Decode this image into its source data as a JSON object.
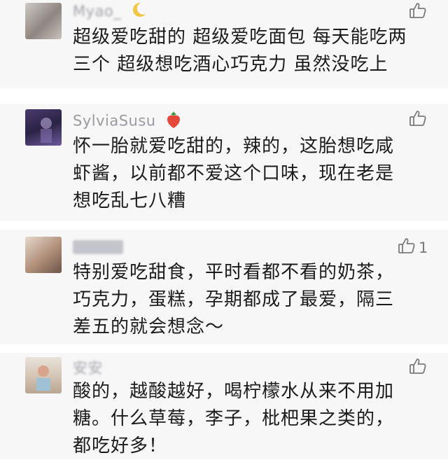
{
  "comments": [
    {
      "nickname": "Myao_",
      "nickname_blurred": true,
      "badge_icon": "crescent-moon-icon",
      "text_lines": [
        "超级爱吃甜的 超级爱吃面包 每天能吃两",
        "三个 超级想吃酒心巧克力 虽然没吃上"
      ],
      "likes": ""
    },
    {
      "nickname": "SylviaSusu",
      "nickname_blurred": false,
      "badge_icon": "strawberry-icon",
      "text_lines": [
        "怀一胎就爱吃甜的，辣的，这胎想吃咸",
        "虾酱，以前都不爱这个口味，现在老是",
        "想吃乱七八糟"
      ],
      "likes": ""
    },
    {
      "nickname": "",
      "nickname_blurred": true,
      "badge_icon": "",
      "text_lines": [
        "特别爱吃甜食，平时看都不看的奶茶，",
        "巧克力，蛋糕，孕期都成了最爱，隔三",
        "差五的就会想念～"
      ],
      "likes": "1"
    },
    {
      "nickname": "安安",
      "nickname_blurred": true,
      "badge_icon": "",
      "text_lines": [
        "酸的，越酸越好，喝柠檬水从来不用加",
        "糖。什么草莓，李子，枇杷果之类的，",
        "都吃好多！"
      ],
      "likes": ""
    }
  ],
  "icons": {
    "like": "thumbs-up-icon",
    "moon_color": "#f3c544",
    "strawberry_color": "#e5483a"
  }
}
